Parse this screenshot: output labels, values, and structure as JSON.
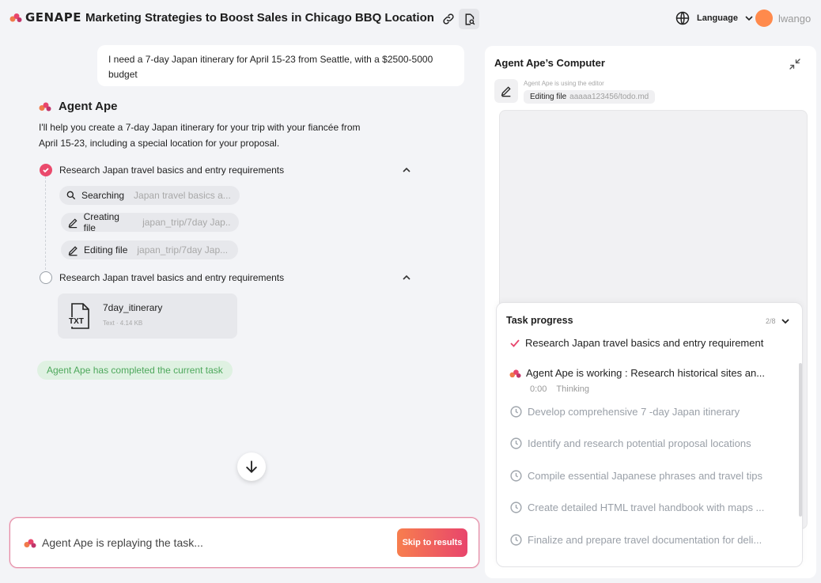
{
  "header": {
    "logo_text": "GENAPE",
    "title": "Marketing Strategies to Boost Sales in Chicago BBQ Location",
    "language_label": "Language",
    "username": "lwango"
  },
  "chat": {
    "user_message": "I need a 7-day Japan itinerary for April 15-23 from Seattle, with a $2500-5000 budget",
    "agent_name": "Agent Ape",
    "agent_intro": "I'll help you create a 7-day Japan itinerary for your trip with your fiancée from April 15-23, including a special location for your proposal.",
    "steps": [
      {
        "label": "Research Japan travel basics and entry requirements",
        "status": "done",
        "actions": [
          {
            "icon": "search-icon",
            "label": "Searching",
            "detail": "Japan travel basics a..."
          },
          {
            "icon": "pencil-icon",
            "label": "Creating file",
            "detail": "japan_trip/7day Jap..."
          },
          {
            "icon": "pencil-icon",
            "label": "Editing file",
            "detail": "japan_trip/7day Jap..."
          }
        ]
      },
      {
        "label": "Research Japan travel basics and entry requirements",
        "status": "pending",
        "file": {
          "name": "7day_itinerary",
          "type_badge": "TXT",
          "meta": "Text · 4.14 KB"
        }
      }
    ],
    "completed_badge": "Agent Ape has completed the current task",
    "input_placeholder": "Agent Ape is replaying the task...",
    "skip_button": "Skip to results"
  },
  "computer": {
    "title": "Agent Ape’s Computer",
    "tool_status": "Agent Ape is using the editor",
    "tool_action": "Editing file",
    "tool_path": "aaaaa123456/todo.md"
  },
  "task_progress": {
    "title": "Task progress",
    "count": "2/8",
    "items": [
      {
        "status": "done",
        "label": "Research Japan travel basics and entry requirement"
      },
      {
        "status": "working",
        "label": "Agent Ape is working : Research historical sites an...",
        "time": "0:00",
        "state": "Thinking"
      },
      {
        "status": "pending",
        "label": "Develop comprehensive 7 -day Japan itinerary"
      },
      {
        "status": "pending",
        "label": "Identify and research potential proposal locations"
      },
      {
        "status": "pending",
        "label": "Compile essential Japanese phrases and travel tips"
      },
      {
        "status": "pending",
        "label": "Create detailed HTML travel handbook with maps ..."
      },
      {
        "status": "pending",
        "label": "Finalize and prepare travel documentation for deli..."
      }
    ]
  },
  "colors": {
    "accent": "#ea4a6c",
    "accent_orange": "#f77e4e",
    "success_bg": "#dff1e2",
    "success_text": "#4ea85c"
  }
}
